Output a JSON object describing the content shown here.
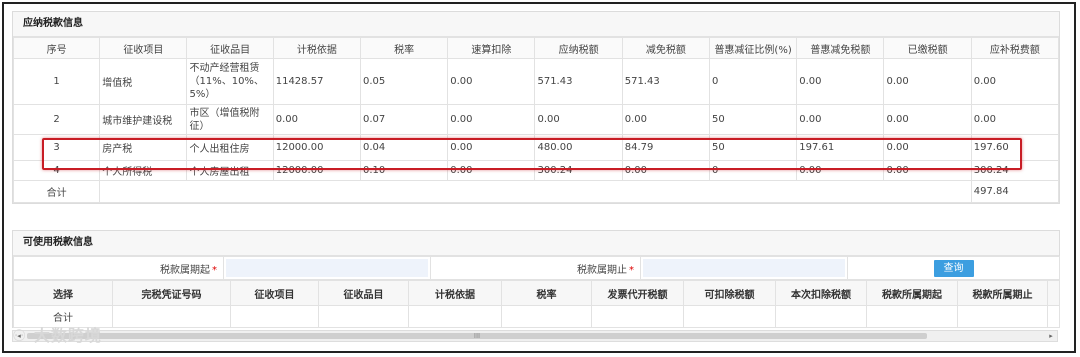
{
  "tax_panel": {
    "title": "应纳税款信息",
    "columns": [
      "序号",
      "征收项目",
      "征收品目",
      "计税依据",
      "税率",
      "速算扣除",
      "应纳税额",
      "减免税额",
      "普惠减征比例(%)",
      "普惠减免税额",
      "已缴税额",
      "应补税费额"
    ],
    "rows": [
      {
        "no": "1",
        "item": "增值税",
        "sub": "不动产经营租赁（11%、10%、5%）",
        "basis": "11428.57",
        "rate": "0.05",
        "quick": "0.00",
        "payable": "571.43",
        "reduce": "571.43",
        "ratio": "0",
        "phreduce": "0.00",
        "paid": "0.00",
        "due": "0.00"
      },
      {
        "no": "2",
        "item": "城市维护建设税",
        "sub": "市区（增值税附征）",
        "basis": "0.00",
        "rate": "0.07",
        "quick": "0.00",
        "payable": "0.00",
        "reduce": "0.00",
        "ratio": "50",
        "phreduce": "0.00",
        "paid": "0.00",
        "due": "0.00"
      },
      {
        "no": "3",
        "item": "房产税",
        "sub": "个人出租住房",
        "basis": "12000.00",
        "rate": "0.04",
        "quick": "0.00",
        "payable": "480.00",
        "reduce": "84.79",
        "ratio": "50",
        "phreduce": "197.61",
        "paid": "0.00",
        "due": "197.60"
      },
      {
        "no": "4",
        "item": "个人所得税",
        "sub": "个人房屋出租",
        "basis": "12000.00",
        "rate": "0.10",
        "quick": "0.00",
        "payable": "300.24",
        "reduce": "0.00",
        "ratio": "0",
        "phreduce": "0.00",
        "paid": "0.00",
        "due": "300.24"
      }
    ],
    "total_label": "合计",
    "total_value": "497.84"
  },
  "avail_panel": {
    "title": "可使用税款信息",
    "start_label": "税款属期起",
    "end_label": "税款属期止",
    "required_mark": "*",
    "query_button": "查询",
    "columns": [
      "选择",
      "完税凭证号码",
      "征收项目",
      "征收品目",
      "计税依据",
      "税率",
      "发票代开税额",
      "可扣除税额",
      "本次扣除税额",
      "税款所属期起",
      "税款所属期止"
    ],
    "total_label": "合计"
  },
  "scrollbar": {
    "left_arrow": "◂",
    "right_arrow": "▸",
    "grip": "III"
  },
  "watermark": "大数跨境"
}
